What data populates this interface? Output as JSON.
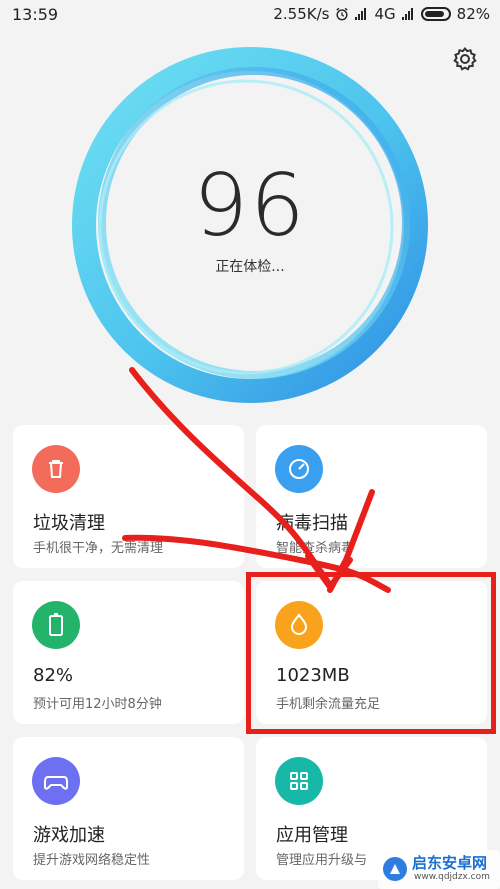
{
  "status_bar": {
    "time": "13:59",
    "speed": "2.55K/s",
    "network": "4G",
    "battery": "82%"
  },
  "gauge": {
    "score": "96",
    "status": "正在体检...",
    "colors": {
      "outer": "#4fc8ef",
      "inner": "#3aa3e6"
    }
  },
  "cards": [
    {
      "title": "垃圾清理",
      "subtitle": "手机很干净，无需清理",
      "icon": "trash-icon",
      "color": "#f26b5b"
    },
    {
      "title": "病毒扫描",
      "subtitle": "智能查杀病毒",
      "icon": "shield-scan-icon",
      "color": "#3b9ff0"
    },
    {
      "title": "82%",
      "subtitle": "预计可用12小时8分钟",
      "icon": "battery-icon",
      "color": "#24b36b"
    },
    {
      "title": "1023MB",
      "subtitle": "手机剩余流量充足",
      "icon": "drop-icon",
      "color": "#f9a21b"
    },
    {
      "title": "游戏加速",
      "subtitle": "提升游戏网络稳定性",
      "icon": "gamepad-icon",
      "color": "#6d70f0"
    },
    {
      "title": "应用管理",
      "subtitle": "管理应用升级与",
      "icon": "apps-grid-icon",
      "color": "#17b8a8"
    }
  ],
  "annotation": {
    "color": "#e8201c"
  },
  "watermark": {
    "name": "启东安卓网",
    "url": "www.qdjdzx.com"
  }
}
